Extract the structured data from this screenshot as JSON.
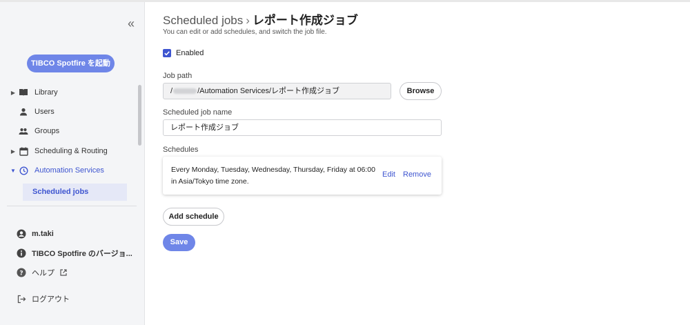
{
  "sidebar": {
    "launch_label": "TIBCO Spotfire を起動",
    "nav": [
      {
        "label": "Library",
        "icon": "book-icon"
      },
      {
        "label": "Users",
        "icon": "person-icon"
      },
      {
        "label": "Groups",
        "icon": "group-icon"
      },
      {
        "label": "Scheduling & Routing",
        "icon": "calendar-icon"
      },
      {
        "label": "Automation Services",
        "icon": "clock-icon"
      }
    ],
    "sub_item": "Scheduled jobs",
    "footer": [
      {
        "label": "m.taki",
        "icon": "account-icon"
      },
      {
        "label": "TIBCO Spotfire のバージョ...",
        "icon": "info-icon"
      },
      {
        "label": "ヘルプ",
        "icon": "help-icon"
      },
      {
        "label": "ログアウト",
        "icon": "logout-icon"
      }
    ]
  },
  "header": {
    "breadcrumb": "Scheduled jobs",
    "separator": "›",
    "title": "レポート作成ジョブ",
    "subtitle": "You can edit or add schedules, and switch the job file."
  },
  "form": {
    "enabled_label": "Enabled",
    "job_path_label": "Job path",
    "job_path_prefix": "/",
    "job_path_value": "/Automation Services/レポート作成ジョブ",
    "browse_label": "Browse",
    "job_name_label": "Scheduled job name",
    "job_name_value": "レポート作成ジョブ",
    "schedules_label": "Schedules",
    "schedule_text": "Every Monday, Tuesday, Wednesday, Thursday, Friday at 06:00 in Asia/Tokyo time zone.",
    "edit_label": "Edit",
    "remove_label": "Remove",
    "add_schedule_label": "Add schedule",
    "save_label": "Save"
  },
  "colors": {
    "accent": "#3e55d0",
    "primary_button": "#6f86e8"
  }
}
